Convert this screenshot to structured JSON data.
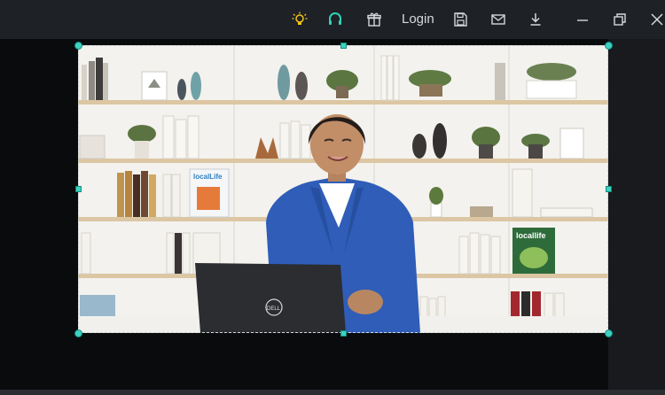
{
  "toolbar": {
    "login_label": "Login",
    "accent_color": "#f5c518",
    "support_color": "#2fd3b4",
    "icons": [
      "bulb-icon",
      "headset-icon",
      "gift-icon",
      "save-icon",
      "mail-icon",
      "download-icon",
      "minimize-icon",
      "restore-icon",
      "close-icon"
    ]
  },
  "video": {
    "book_label_1": "localLife",
    "book_label_2": "locallife",
    "laptop_brand": "DELL"
  },
  "selection": {
    "handle_color": "#3fd1bf"
  }
}
